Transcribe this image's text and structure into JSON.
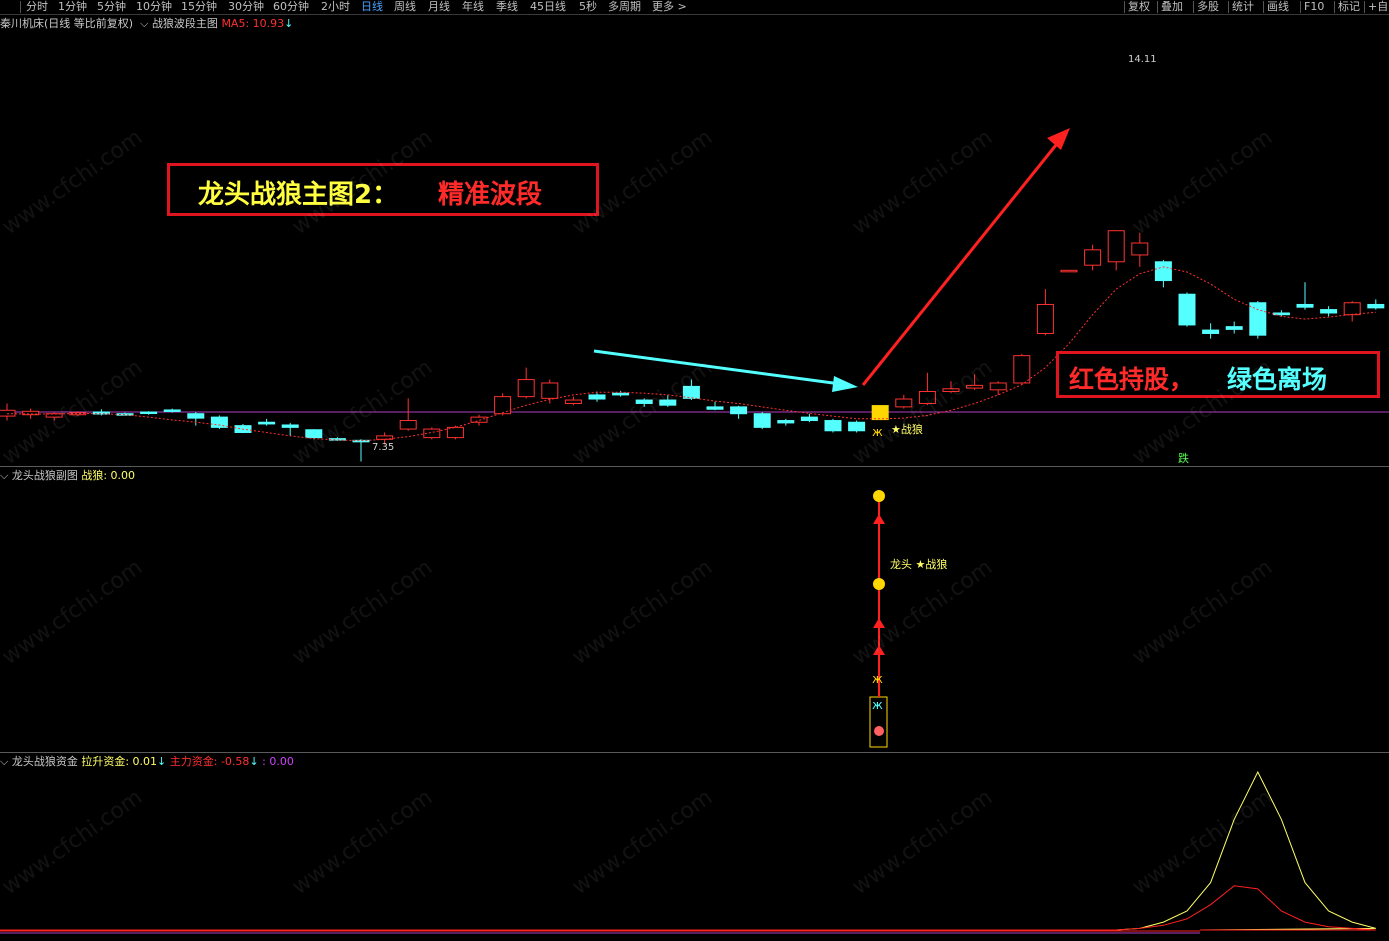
{
  "toolbar": {
    "period_tabs": [
      "分时",
      "1分钟",
      "5分钟",
      "10分钟",
      "15分钟",
      "30分钟",
      "60分钟",
      "2小时",
      "日线",
      "周线",
      "月线",
      "年线",
      "季线",
      "45日线",
      "5秒",
      "多周期",
      "更多 >"
    ],
    "active_tab": "日线",
    "right_tools": [
      "复权",
      "叠加",
      "多股",
      "统计",
      "画线",
      "F10",
      "标记",
      "+自"
    ]
  },
  "main_pane": {
    "stock_title": "秦川机床(日线 等比前复权)",
    "indicator_name": "战狼波段主图",
    "ma_label": "MA5: 10.93",
    "ma_arrow": "↓",
    "high_label": "14.11",
    "low_label": "7.35",
    "signal_label": "★战狼",
    "fall_label": "跌",
    "banner_title_yellow": "龙头战狼主图2：",
    "banner_title_red": "精准波段",
    "banner_note_red": "红色持股，",
    "banner_note_cyan": "绿色离场"
  },
  "sub_pane": {
    "indicator_name": "龙头战狼副图",
    "value_label": "战狼: 0.00",
    "signal_label": "龙头 ★战狼"
  },
  "fund_pane": {
    "indicator_name": "龙头战狼资金",
    "lift_label": "拉升资金: 0.01",
    "lift_arrow": "↓",
    "main_label": "主力资金: -0.58",
    "main_arrow": "↓",
    "extra_label": ": 0.00"
  },
  "watermark": "www.cfchi.com",
  "colors": {
    "up": "#ff3232",
    "down": "#54ffff",
    "ma_line": "#ff3030",
    "zero_line": "#b040c0",
    "lift_line": "#ffff66",
    "main_line": "#ff2020",
    "active_tab": "#4aa3ff"
  },
  "chart_data": {
    "type": "candlestick",
    "price_range": [
      7.0,
      14.5
    ],
    "candles": [
      {
        "o": 8.85,
        "c": 8.68,
        "h": 9.05,
        "l": 8.55,
        "dir": "up"
      },
      {
        "o": 8.72,
        "c": 8.82,
        "h": 8.9,
        "l": 8.6,
        "dir": "up"
      },
      {
        "o": 8.65,
        "c": 8.75,
        "h": 8.8,
        "l": 8.55,
        "dir": "up"
      },
      {
        "o": 8.72,
        "c": 8.78,
        "h": 8.82,
        "l": 8.68,
        "dir": "up"
      },
      {
        "o": 8.8,
        "c": 8.74,
        "h": 8.88,
        "l": 8.7,
        "dir": "down"
      },
      {
        "o": 8.75,
        "c": 8.72,
        "h": 8.78,
        "l": 8.7,
        "dir": "down"
      },
      {
        "o": 8.76,
        "c": 8.8,
        "h": 8.82,
        "l": 8.72,
        "dir": "down"
      },
      {
        "o": 8.82,
        "c": 8.86,
        "h": 8.9,
        "l": 8.78,
        "dir": "down"
      },
      {
        "o": 8.75,
        "c": 8.62,
        "h": 8.8,
        "l": 8.4,
        "dir": "down"
      },
      {
        "o": 8.65,
        "c": 8.35,
        "h": 8.7,
        "l": 8.3,
        "dir": "down"
      },
      {
        "o": 8.4,
        "c": 8.2,
        "h": 8.45,
        "l": 8.18,
        "dir": "down"
      },
      {
        "o": 8.5,
        "c": 8.45,
        "h": 8.6,
        "l": 8.4,
        "dir": "down"
      },
      {
        "o": 8.42,
        "c": 8.35,
        "h": 8.48,
        "l": 8.1,
        "dir": "down"
      },
      {
        "o": 8.28,
        "c": 8.05,
        "h": 8.3,
        "l": 8.0,
        "dir": "down"
      },
      {
        "o": 8.02,
        "c": 8.0,
        "h": 8.06,
        "l": 7.95,
        "dir": "down"
      },
      {
        "o": 7.97,
        "c": 7.93,
        "h": 8.0,
        "l": 7.35,
        "dir": "down"
      },
      {
        "o": 8.0,
        "c": 8.1,
        "h": 8.2,
        "l": 7.85,
        "dir": "up"
      },
      {
        "o": 8.3,
        "c": 8.55,
        "h": 9.2,
        "l": 8.25,
        "dir": "up"
      },
      {
        "o": 8.05,
        "c": 8.3,
        "h": 8.35,
        "l": 8.0,
        "dir": "up"
      },
      {
        "o": 8.05,
        "c": 8.35,
        "h": 8.4,
        "l": 8.0,
        "dir": "up"
      },
      {
        "o": 8.5,
        "c": 8.65,
        "h": 8.72,
        "l": 8.4,
        "dir": "up"
      },
      {
        "o": 8.75,
        "c": 9.25,
        "h": 9.35,
        "l": 8.7,
        "dir": "up"
      },
      {
        "o": 9.25,
        "c": 9.75,
        "h": 10.1,
        "l": 9.2,
        "dir": "up"
      },
      {
        "o": 9.2,
        "c": 9.65,
        "h": 9.75,
        "l": 9.05,
        "dir": "up"
      },
      {
        "o": 9.05,
        "c": 9.15,
        "h": 9.25,
        "l": 9.0,
        "dir": "up"
      },
      {
        "o": 9.18,
        "c": 9.3,
        "h": 9.4,
        "l": 9.1,
        "dir": "down"
      },
      {
        "o": 9.35,
        "c": 9.3,
        "h": 9.42,
        "l": 9.25,
        "dir": "down"
      },
      {
        "o": 9.15,
        "c": 9.05,
        "h": 9.2,
        "l": 8.95,
        "dir": "down"
      },
      {
        "o": 9.15,
        "c": 9.0,
        "h": 9.3,
        "l": 8.95,
        "dir": "down"
      },
      {
        "o": 9.55,
        "c": 9.2,
        "h": 9.75,
        "l": 9.15,
        "dir": "down"
      },
      {
        "o": 8.95,
        "c": 8.88,
        "h": 9.1,
        "l": 8.85,
        "dir": "down"
      },
      {
        "o": 8.95,
        "c": 8.75,
        "h": 8.98,
        "l": 8.6,
        "dir": "down"
      },
      {
        "o": 8.75,
        "c": 8.35,
        "h": 8.8,
        "l": 8.3,
        "dir": "down"
      },
      {
        "o": 8.55,
        "c": 8.48,
        "h": 8.6,
        "l": 8.4,
        "dir": "down"
      },
      {
        "o": 8.65,
        "c": 8.55,
        "h": 8.75,
        "l": 8.5,
        "dir": "down"
      },
      {
        "o": 8.55,
        "c": 8.25,
        "h": 8.6,
        "l": 8.2,
        "dir": "down"
      },
      {
        "o": 8.5,
        "c": 8.25,
        "h": 8.55,
        "l": 8.2,
        "dir": "down"
      },
      {
        "o": 8.65,
        "c": 8.9,
        "h": 8.92,
        "l": 8.6,
        "dir": "up",
        "signal": true
      },
      {
        "o": 8.95,
        "c": 9.18,
        "h": 9.3,
        "l": 8.9,
        "dir": "up"
      },
      {
        "o": 9.05,
        "c": 9.4,
        "h": 9.95,
        "l": 9.0,
        "dir": "up"
      },
      {
        "o": 9.4,
        "c": 9.48,
        "h": 9.7,
        "l": 9.35,
        "dir": "up"
      },
      {
        "o": 9.5,
        "c": 9.58,
        "h": 9.9,
        "l": 9.45,
        "dir": "up"
      },
      {
        "o": 9.45,
        "c": 9.65,
        "h": 9.7,
        "l": 9.3,
        "dir": "up"
      },
      {
        "o": 9.65,
        "c": 10.45,
        "h": 10.5,
        "l": 9.6,
        "dir": "up"
      },
      {
        "o": 11.1,
        "c": 11.95,
        "h": 12.4,
        "l": 11.05,
        "dir": "up"
      },
      {
        "o": 12.95,
        "c": 12.95,
        "h": 12.95,
        "l": 12.95,
        "dir": "up"
      },
      {
        "o": 13.1,
        "c": 13.55,
        "h": 13.7,
        "l": 12.95,
        "dir": "up"
      },
      {
        "o": 13.2,
        "c": 14.11,
        "h": 14.11,
        "l": 12.95,
        "dir": "up"
      },
      {
        "o": 13.4,
        "c": 13.75,
        "h": 14.05,
        "l": 13.05,
        "dir": "up"
      },
      {
        "o": 13.2,
        "c": 12.65,
        "h": 13.25,
        "l": 12.45,
        "dir": "down"
      },
      {
        "o": 12.25,
        "c": 11.35,
        "h": 12.3,
        "l": 11.3,
        "dir": "down"
      },
      {
        "o": 11.2,
        "c": 11.1,
        "h": 11.4,
        "l": 10.95,
        "dir": "down"
      },
      {
        "o": 11.3,
        "c": 11.22,
        "h": 11.45,
        "l": 11.1,
        "dir": "down"
      },
      {
        "o": 12.0,
        "c": 11.05,
        "h": 12.05,
        "l": 10.95,
        "dir": "down"
      },
      {
        "o": 11.7,
        "c": 11.65,
        "h": 11.78,
        "l": 11.6,
        "dir": "down"
      },
      {
        "o": 11.95,
        "c": 11.87,
        "h": 12.6,
        "l": 11.8,
        "dir": "down"
      },
      {
        "o": 11.8,
        "c": 11.7,
        "h": 11.9,
        "l": 11.6,
        "dir": "down"
      },
      {
        "o": 11.65,
        "c": 12.0,
        "h": 12.05,
        "l": 11.45,
        "dir": "up"
      },
      {
        "o": 11.95,
        "c": 11.85,
        "h": 12.1,
        "l": 11.8,
        "dir": "down"
      }
    ],
    "ma5": [
      8.75,
      8.74,
      8.74,
      8.76,
      8.75,
      8.72,
      8.65,
      8.57,
      8.5,
      8.42,
      8.3,
      8.2,
      8.1,
      8.02,
      7.98,
      7.96,
      8.0,
      8.08,
      8.2,
      8.35,
      8.55,
      8.78,
      9.0,
      9.17,
      9.3,
      9.38,
      9.38,
      9.35,
      9.3,
      9.22,
      9.12,
      9.05,
      8.95,
      8.85,
      8.76,
      8.68,
      8.6,
      8.6,
      8.62,
      8.7,
      8.85,
      9.05,
      9.3,
      9.6,
      10.1,
      10.8,
      11.65,
      12.4,
      12.85,
      13.05,
      12.9,
      12.55,
      12.1,
      11.8,
      11.6,
      11.52,
      11.58,
      11.66,
      11.72
    ],
    "lift_fund": [
      0,
      0,
      0,
      0,
      0,
      0,
      0,
      0,
      0,
      0,
      0,
      0,
      0,
      0,
      0,
      0,
      0,
      0,
      0,
      0,
      0,
      0,
      0,
      0,
      0,
      0,
      0,
      0,
      0,
      0,
      0,
      0,
      0,
      0,
      0,
      0,
      0,
      0,
      0,
      0,
      0,
      0,
      0.01,
      0.05,
      0.12,
      0.3,
      0.7,
      1.0,
      0.7,
      0.3,
      0.12,
      0.05,
      0.01
    ],
    "main_fund": [
      0,
      0,
      0,
      0,
      0,
      0,
      0,
      0,
      0,
      0,
      0,
      0,
      0,
      0,
      0,
      0,
      0,
      0,
      0,
      0,
      0,
      0,
      0,
      0,
      0,
      0,
      0,
      0,
      0,
      0,
      0,
      0,
      0,
      0,
      0,
      0,
      0,
      0,
      0,
      0,
      0,
      0,
      0.01,
      0.03,
      0.07,
      0.16,
      0.28,
      0.26,
      0.12,
      0.05,
      0.02,
      0.01,
      0
    ]
  }
}
